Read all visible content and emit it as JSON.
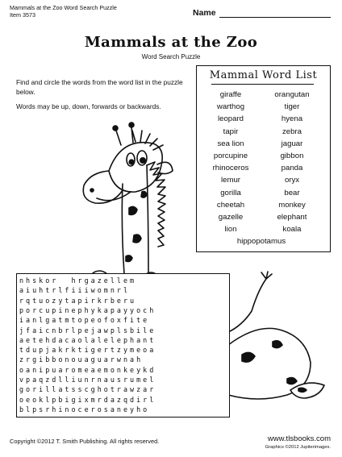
{
  "header": {
    "line1": "Mammals at the Zoo Word Search Puzzle",
    "line2": "Item 3573",
    "name_label": "Name"
  },
  "title": "Mammals at the Zoo",
  "subtitle": "Word Search Puzzle",
  "instructions": {
    "p1": "Find and circle the words from the word list in the puzzle below.",
    "p2": "Words may be up, down, forwards or backwards."
  },
  "word_list": {
    "title": "Mammal Word List",
    "left": [
      "giraffe",
      "warthog",
      "leopard",
      "tapir",
      "sea lion",
      "porcupine",
      "rhinoceros",
      "lemur",
      "gorilla",
      "cheetah",
      "gazelle",
      "lion"
    ],
    "right": [
      "orangutan",
      "tiger",
      "hyena",
      "zebra",
      "jaguar",
      "gibbon",
      "panda",
      "oryx",
      "bear",
      "monkey",
      "elephant",
      "koala"
    ],
    "last": "hippopotamus"
  },
  "grid_rows": [
    "nhskor  hrgazellem",
    "aiuhtrlfiiiwomnrl",
    "rqtuozytapirkrberu",
    "porcupinephykapayyoch",
    "ianlgatmtopeofoxfite",
    "jfaicnbrlpejawplsbile",
    "aetehdacaolalelephant",
    "tdupjakrktigertzymeoa",
    "zrgibbonouaguarwnah",
    "oanipuaromeaemonkeykd",
    "vpaqzdlliunrnausrumel",
    "gorillatsscghotrawzar",
    "oeoklpbigixmrdazqdirl",
    "blpsrhinocerosaneyho"
  ],
  "footer": {
    "copyright": "Copyright ©2012 T. Smith Publishing. All rights reserved.",
    "site": "www.tlsbooks.com",
    "graphics": "Graphics ©2012 Jupiterimages."
  }
}
